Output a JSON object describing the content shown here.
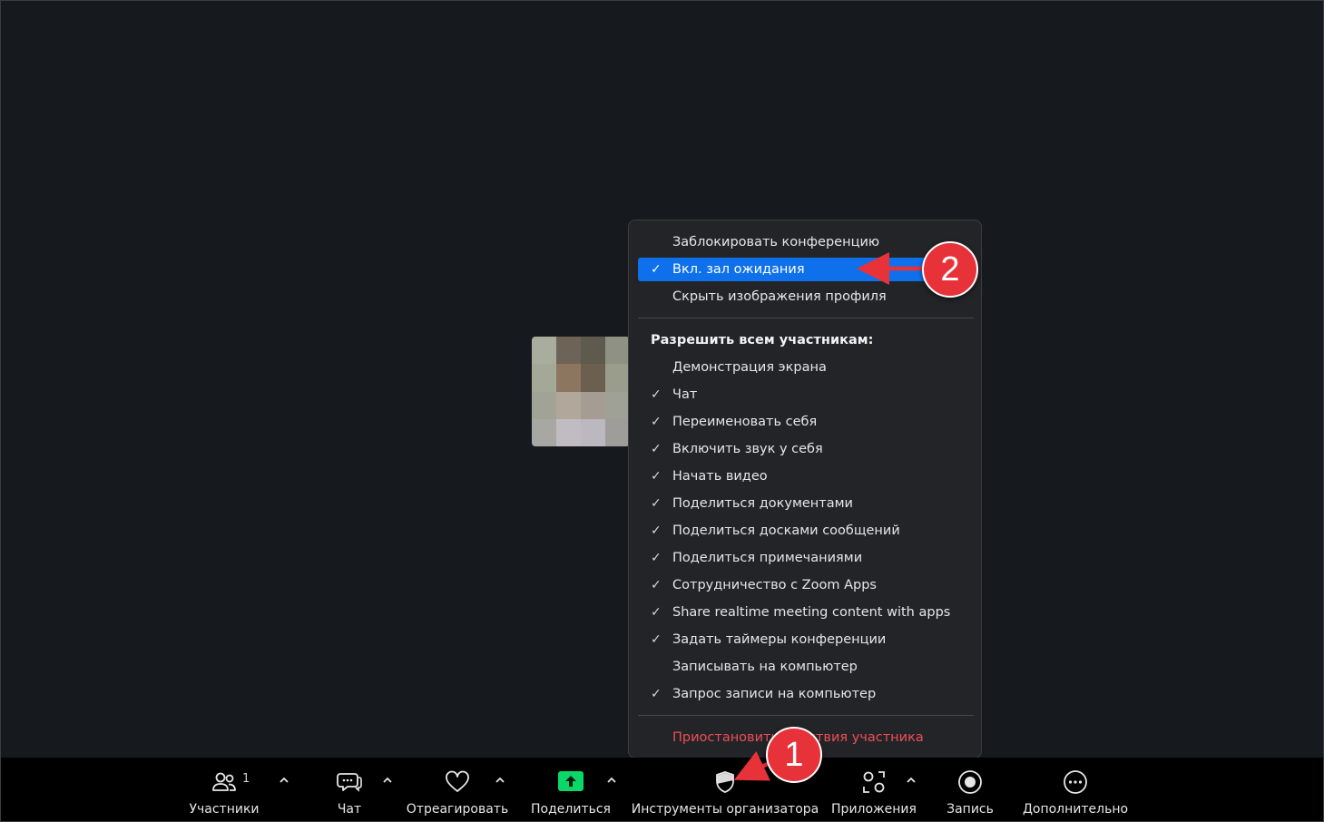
{
  "menu": {
    "items_top": [
      {
        "label": "Заблокировать конференцию",
        "checked": false,
        "selected": false
      },
      {
        "label": "Вкл. зал ожидания",
        "checked": true,
        "selected": true
      },
      {
        "label": "Скрыть изображения профиля",
        "checked": false,
        "selected": false
      }
    ],
    "section_header": "Разрешить всем участникам:",
    "items_allow": [
      {
        "label": "Демонстрация экрана",
        "checked": false
      },
      {
        "label": "Чат",
        "checked": true
      },
      {
        "label": "Переименовать себя",
        "checked": true
      },
      {
        "label": "Включить звук у себя",
        "checked": true
      },
      {
        "label": "Начать видео",
        "checked": true
      },
      {
        "label": "Поделиться документами",
        "checked": true
      },
      {
        "label": "Поделиться досками сообщений",
        "checked": true
      },
      {
        "label": "Поделиться примечаниями",
        "checked": true
      },
      {
        "label": "Сотрудничество с Zoom Apps",
        "checked": true
      },
      {
        "label": "Share realtime meeting content with apps",
        "checked": true
      },
      {
        "label": "Задать таймеры конференции",
        "checked": true
      },
      {
        "label": "Записывать на компьютер",
        "checked": false
      },
      {
        "label": "Запрос записи на компьютер",
        "checked": true
      }
    ],
    "danger_item": "Приостановить действия участника",
    "check_glyph": "✓"
  },
  "toolbar": {
    "participants": {
      "label": "Участники",
      "count": "1",
      "icon": "participants-icon"
    },
    "chat": {
      "label": "Чат",
      "icon": "chat-icon"
    },
    "react": {
      "label": "Отреагировать",
      "icon": "heart-icon"
    },
    "share": {
      "label": "Поделиться",
      "icon": "share-screen-icon"
    },
    "host_tools": {
      "label": "Инструменты организатора",
      "icon": "shield-icon"
    },
    "apps": {
      "label": "Приложения",
      "icon": "apps-icon"
    },
    "record": {
      "label": "Запись",
      "icon": "record-icon"
    },
    "more": {
      "label": "Дополнительно",
      "icon": "more-icon"
    }
  },
  "annotations": {
    "step1": "1",
    "step2": "2"
  },
  "colors": {
    "accent": "#0e71eb",
    "share_green": "#0bd668",
    "danger": "#ec4f56",
    "annotation": "#e8323a"
  }
}
